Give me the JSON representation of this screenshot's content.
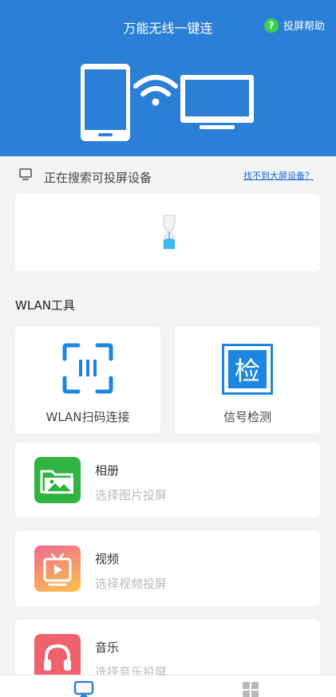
{
  "header": {
    "title": "万能无线一键连",
    "help_label": "投屏帮助",
    "help_icon": "?"
  },
  "status": {
    "text": "正在搜索可投屏设备",
    "link": "找不到大屏设备？"
  },
  "wlan_section": {
    "title": "WLAN工具",
    "tools": [
      {
        "label": "WLAN扫码连接",
        "icon": "qr-scan-icon"
      },
      {
        "label": "信号检测",
        "icon_text": "检",
        "icon": "signal-check-icon"
      }
    ]
  },
  "list": [
    {
      "title": "相册",
      "subtitle": "选择图片投屏",
      "icon": "album-icon",
      "color": "#2fb341"
    },
    {
      "title": "视频",
      "subtitle": "选择视频投屏",
      "icon": "video-icon",
      "color": "#f8735a"
    },
    {
      "title": "音乐",
      "subtitle": "选择音乐投屏",
      "icon": "music-icon",
      "color": "#f0616e"
    }
  ],
  "colors": {
    "header": "#2b7fd6",
    "accent": "#1a66d6"
  }
}
